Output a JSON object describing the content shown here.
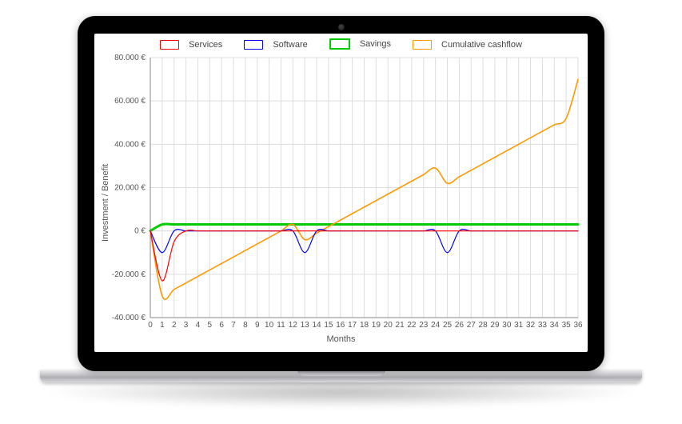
{
  "legend": {
    "services": "Services",
    "software": "Software",
    "savings": "Savings",
    "cumulative": "Cumulative cashflow"
  },
  "axes": {
    "ylabel": "Investment / Benefit",
    "xlabel": "Months",
    "yticks": [
      "80.000 €",
      "60.000 €",
      "40.000 €",
      "20.000 €",
      "0 €",
      "-20.000 €",
      "-40.000 €"
    ],
    "xticks": [
      "0",
      "1",
      "2",
      "3",
      "4",
      "5",
      "6",
      "7",
      "8",
      "9",
      "10",
      "11",
      "12",
      "13",
      "14",
      "15",
      "16",
      "17",
      "18",
      "19",
      "20",
      "21",
      "22",
      "23",
      "24",
      "25",
      "26",
      "27",
      "28",
      "29",
      "30",
      "31",
      "32",
      "33",
      "34",
      "35",
      "36"
    ]
  },
  "colors": {
    "services": "#ff0000",
    "software": "#0000ff",
    "savings": "#00cc00",
    "cumulative": "#ff9900",
    "grid": "#dddddd",
    "axis": "#888888"
  },
  "chart_data": {
    "type": "line",
    "title": "",
    "xlabel": "Months",
    "ylabel": "Investment / Benefit",
    "x": [
      0,
      1,
      2,
      3,
      4,
      5,
      6,
      7,
      8,
      9,
      10,
      11,
      12,
      13,
      14,
      15,
      16,
      17,
      18,
      19,
      20,
      21,
      22,
      23,
      24,
      25,
      26,
      27,
      28,
      29,
      30,
      31,
      32,
      33,
      34,
      35,
      36
    ],
    "ylim": [
      -40000,
      80000
    ],
    "xlim": [
      0,
      36
    ],
    "currency": "€",
    "series": [
      {
        "name": "Services",
        "color": "#ff0000",
        "values": [
          0,
          -23000,
          -5000,
          0,
          0,
          0,
          0,
          0,
          0,
          0,
          0,
          0,
          0,
          0,
          0,
          0,
          0,
          0,
          0,
          0,
          0,
          0,
          0,
          0,
          0,
          0,
          0,
          0,
          0,
          0,
          0,
          0,
          0,
          0,
          0,
          0,
          0
        ]
      },
      {
        "name": "Software",
        "color": "#0000ff",
        "values": [
          0,
          -10000,
          0,
          0,
          0,
          0,
          0,
          0,
          0,
          0,
          0,
          0,
          0,
          -10000,
          0,
          0,
          0,
          0,
          0,
          0,
          0,
          0,
          0,
          0,
          0,
          -10000,
          0,
          0,
          0,
          0,
          0,
          0,
          0,
          0,
          0,
          0,
          0
        ]
      },
      {
        "name": "Savings",
        "color": "#00cc00",
        "values": [
          0,
          3000,
          3000,
          3000,
          3000,
          3000,
          3000,
          3000,
          3000,
          3000,
          3000,
          3000,
          3000,
          3000,
          3000,
          3000,
          3000,
          3000,
          3000,
          3000,
          3000,
          3000,
          3000,
          3000,
          3000,
          3000,
          3000,
          3000,
          3000,
          3000,
          3000,
          3000,
          3000,
          3000,
          3000,
          3000,
          3000
        ]
      },
      {
        "name": "Cumulative cashflow",
        "color": "#ff9900",
        "values": [
          0,
          -30000,
          -27000,
          -24000,
          -21000,
          -18000,
          -15000,
          -12000,
          -9000,
          -6000,
          -3000,
          0,
          3000,
          -4000,
          -1000,
          2000,
          5000,
          8000,
          11000,
          14000,
          17000,
          20000,
          23000,
          26000,
          29000,
          22000,
          25000,
          28000,
          31000,
          34000,
          37000,
          40000,
          43000,
          46000,
          49000,
          52000,
          70000
        ]
      }
    ]
  }
}
